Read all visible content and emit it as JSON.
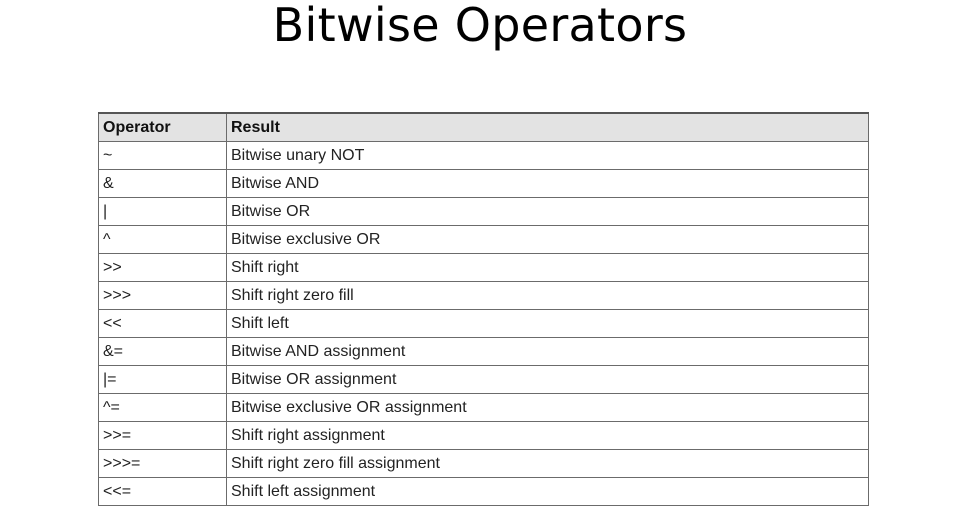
{
  "slide": {
    "title": "Bitwise Operators"
  },
  "table": {
    "headers": [
      "Operator",
      "Result"
    ],
    "rows": [
      [
        "~",
        "Bitwise unary NOT"
      ],
      [
        "&",
        "Bitwise AND"
      ],
      [
        "|",
        "Bitwise OR"
      ],
      [
        "^",
        "Bitwise exclusive OR"
      ],
      [
        ">>",
        "Shift right"
      ],
      [
        ">>>",
        "Shift right zero fill"
      ],
      [
        "<<",
        "Shift left"
      ],
      [
        "&=",
        "Bitwise AND assignment"
      ],
      [
        "|=",
        "Bitwise OR assignment"
      ],
      [
        "^=",
        "Bitwise exclusive OR assignment"
      ],
      [
        ">>=",
        "Shift right assignment"
      ],
      [
        ">>>=",
        "Shift right zero fill assignment"
      ],
      [
        "<<=",
        "Shift left assignment"
      ]
    ]
  },
  "colors": {
    "header_background": "#e3e3e3",
    "border": "#6b6b6b"
  }
}
